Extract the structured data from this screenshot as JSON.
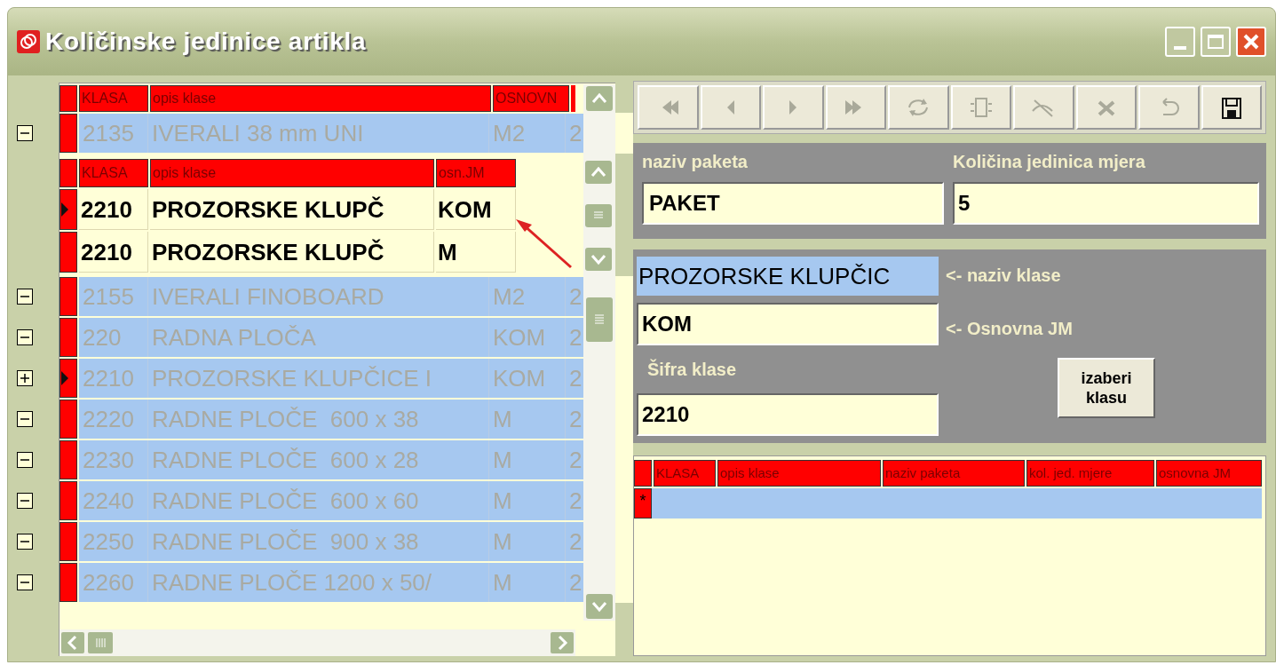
{
  "window": {
    "title": "Količinske jedinice artikla"
  },
  "main_grid": {
    "columns": [
      "KLASA",
      "opis klase",
      "OSNOVN"
    ],
    "rows": [
      {
        "expanded": true,
        "selected": false,
        "cells": [
          "2135",
          "IVERALI 38 mm UNI",
          "M2",
          "2"
        ],
        "subgrid": {
          "columns": [
            "KLASA",
            "opis klase",
            "osn.JM"
          ],
          "rows": [
            {
              "selected": true,
              "cells": [
                "2210",
                "PROZORSKE KLUPČ",
                "KOM"
              ]
            },
            {
              "selected": false,
              "cells": [
                "2210",
                "PROZORSKE KLUPČ",
                "M"
              ]
            }
          ]
        }
      },
      {
        "expanded": true,
        "selected": false,
        "cells": [
          "2155",
          "IVERALI FINOBOARD",
          "M2",
          "2"
        ]
      },
      {
        "expanded": true,
        "selected": false,
        "cells": [
          "220",
          "RADNA PLOČA",
          "KOM",
          "2"
        ]
      },
      {
        "expanded": false,
        "selected": true,
        "cells": [
          "2210",
          "PROZORSKE KLUPČICE I",
          "KOM",
          "2"
        ]
      },
      {
        "expanded": true,
        "selected": false,
        "cells": [
          "2220",
          "RADNE PLOČE  600 x 38",
          "M",
          "2"
        ]
      },
      {
        "expanded": true,
        "selected": false,
        "cells": [
          "2230",
          "RADNE PLOČE  600 x 28",
          "M",
          "2"
        ]
      },
      {
        "expanded": true,
        "selected": false,
        "cells": [
          "2240",
          "RADNE PLOČE  600 x 60",
          "M",
          "2"
        ]
      },
      {
        "expanded": true,
        "selected": false,
        "cells": [
          "2250",
          "RADNE PLOČE  900 x 38",
          "M",
          "2"
        ]
      },
      {
        "expanded": true,
        "selected": false,
        "cells": [
          "2260",
          "RADNE PLOČE 1200 x 50/",
          "M",
          "2"
        ]
      }
    ]
  },
  "toolbar": [
    {
      "kind": "first",
      "disabled": true
    },
    {
      "kind": "prev",
      "disabled": true
    },
    {
      "kind": "next",
      "disabled": true
    },
    {
      "kind": "last",
      "disabled": true
    },
    {
      "kind": "refresh",
      "disabled": true
    },
    {
      "kind": "new",
      "disabled": true
    },
    {
      "kind": "find",
      "disabled": true
    },
    {
      "kind": "delete",
      "disabled": true
    },
    {
      "kind": "undo",
      "disabled": true
    },
    {
      "kind": "save",
      "disabled": false
    }
  ],
  "package_panel": {
    "name_label": "naziv paketa",
    "name_value": "PAKET",
    "qty_label": "Količina jedinica mjera",
    "qty_value": "5"
  },
  "class_panel": {
    "class_name": {
      "value": "PROZORSKE KLUPČIC",
      "selected": true,
      "hint": "<- naziv klase"
    },
    "base_unit": {
      "value": "KOM",
      "hint": "<- Osnovna JM"
    },
    "code_label": "Šifra klase",
    "code_value": "2210",
    "choose_button": "izaberi klasu"
  },
  "detail_grid": {
    "columns": [
      "KLASA",
      "opis klase",
      "naziv paketa",
      "kol. jed. mjere",
      "osnovna JM"
    ],
    "new_row_marker": "*"
  }
}
